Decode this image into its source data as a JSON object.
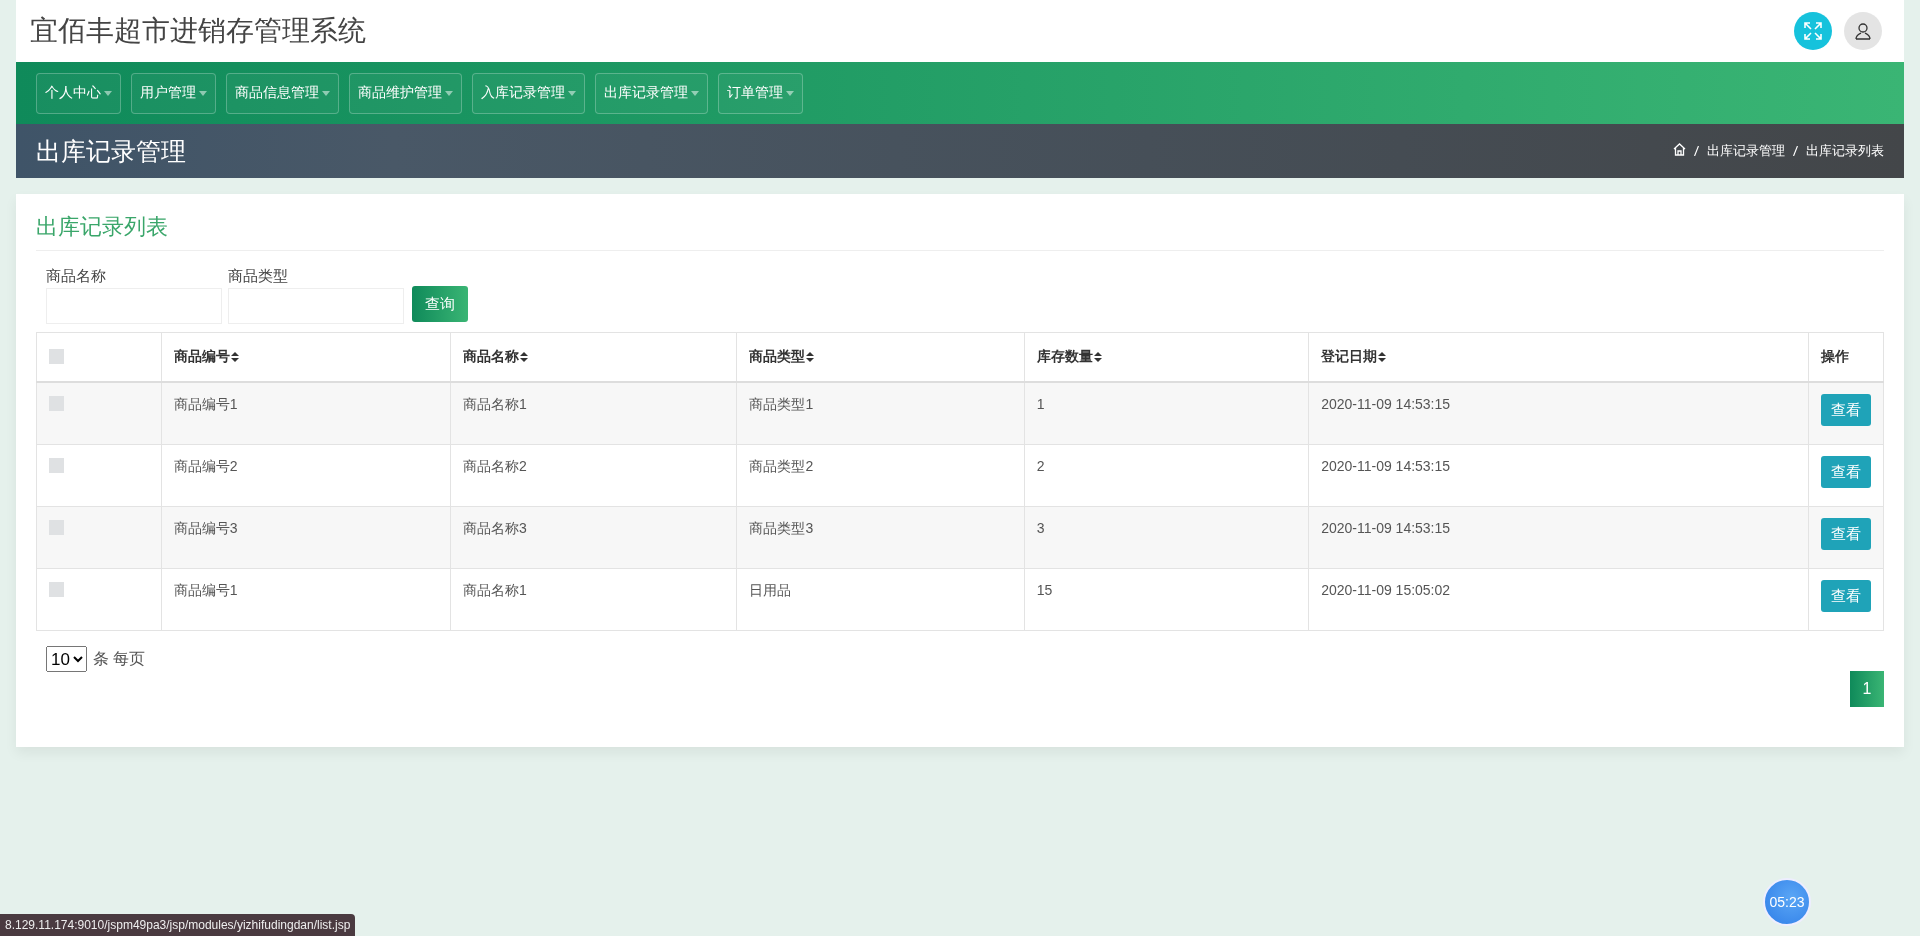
{
  "header": {
    "title": "宜佰丰超市进销存管理系统"
  },
  "nav": {
    "items": [
      {
        "label": "个人中心"
      },
      {
        "label": "用户管理"
      },
      {
        "label": "商品信息管理"
      },
      {
        "label": "商品维护管理"
      },
      {
        "label": "入库记录管理"
      },
      {
        "label": "出库记录管理"
      },
      {
        "label": "订单管理"
      }
    ]
  },
  "page_title": "出库记录管理",
  "breadcrumb": [
    "出库记录管理",
    "出库记录列表"
  ],
  "card": {
    "title": "出库记录列表",
    "filters": [
      {
        "label": "商品名称"
      },
      {
        "label": "商品类型"
      }
    ],
    "search_button": "查询",
    "table": {
      "select_all_checked": false,
      "columns": [
        {
          "label": "商品编号",
          "sortable": true
        },
        {
          "label": "商品名称",
          "sortable": true
        },
        {
          "label": "商品类型",
          "sortable": true
        },
        {
          "label": "库存数量",
          "sortable": true
        },
        {
          "label": "登记日期",
          "sortable": true
        },
        {
          "label": "操作",
          "sortable": false
        }
      ],
      "rows": [
        {
          "checked": false,
          "cells": [
            "商品编号1",
            "商品名称1",
            "商品类型1",
            "1",
            "2020-11-09 14:53:15"
          ],
          "action": "查看"
        },
        {
          "checked": false,
          "cells": [
            "商品编号2",
            "商品名称2",
            "商品类型2",
            "2",
            "2020-11-09 14:53:15"
          ],
          "action": "查看"
        },
        {
          "checked": false,
          "cells": [
            "商品编号3",
            "商品名称3",
            "商品类型3",
            "3",
            "2020-11-09 14:53:15"
          ],
          "action": "查看"
        },
        {
          "checked": false,
          "cells": [
            "商品编号1",
            "商品名称1",
            "日用品",
            "15",
            "2020-11-09 15:05:02"
          ],
          "action": "查看"
        }
      ]
    },
    "page_size": "10",
    "page_size_label": "条 每页",
    "pages": [
      {
        "label": "1",
        "selected": true
      }
    ]
  },
  "status_url": "8.129.11.174:9010/jspm49pa3/jsp/modules/yizhifudingdan/list.jsp",
  "timer": "05:23"
}
